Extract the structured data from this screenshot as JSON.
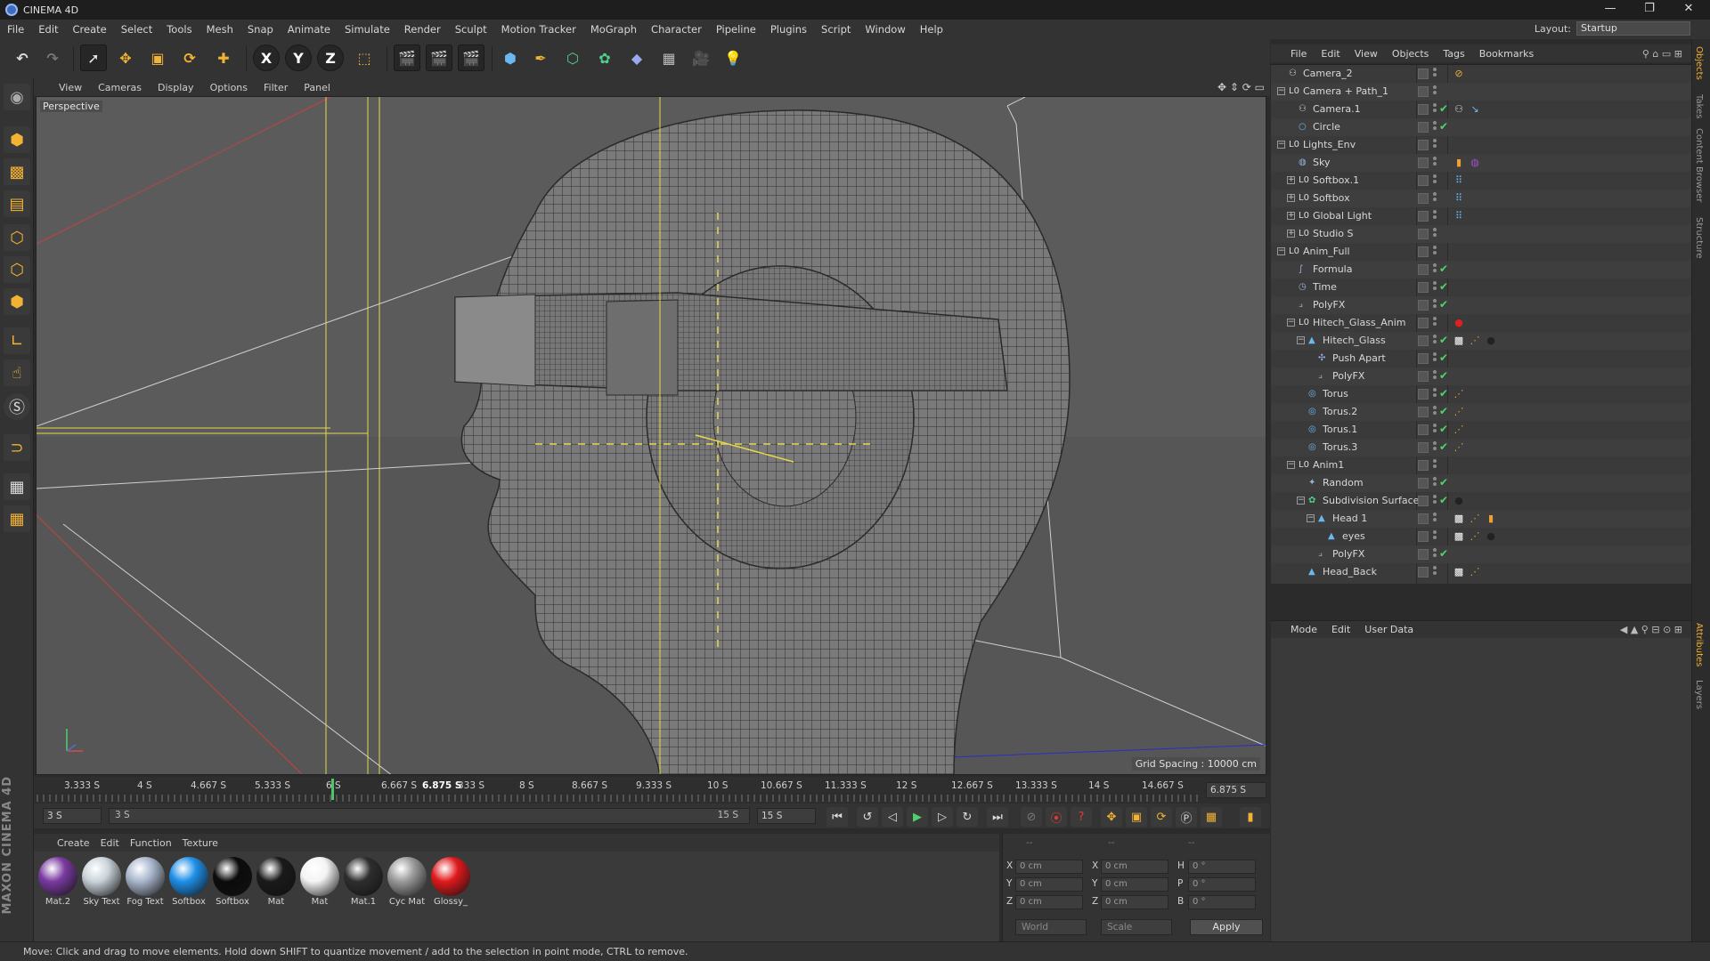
{
  "window": {
    "title": "CINEMA 4D",
    "minimize": "—",
    "restore": "❐",
    "close": "✕"
  },
  "menu": [
    "File",
    "Edit",
    "Create",
    "Select",
    "Tools",
    "Mesh",
    "Snap",
    "Animate",
    "Simulate",
    "Render",
    "Sculpt",
    "Motion Tracker",
    "MoGraph",
    "Character",
    "Pipeline",
    "Plugins",
    "Script",
    "Window",
    "Help"
  ],
  "layout": {
    "label": "Layout:",
    "value": "Startup"
  },
  "toolbar": {
    "x_label": "X",
    "y_label": "Y",
    "z_label": "Z"
  },
  "viewport": {
    "menu": [
      "View",
      "Cameras",
      "Display",
      "Options",
      "Filter",
      "Panel"
    ],
    "camera_label": "Perspective",
    "grid_spacing": "Grid Spacing : 10000 cm"
  },
  "timeline": {
    "ticks": [
      "3.333 S",
      "4 S",
      "4.667 S",
      "5.333 S",
      "6 S",
      "6.667 S",
      "6.875 S",
      "333 S",
      "8 S",
      "8.667 S",
      "9.333 S",
      "10 S",
      "10.667 S",
      "11.333 S",
      "12 S",
      "12.667 S",
      "13.333 S",
      "14 S",
      "14.667 S"
    ],
    "current_time": "6.875 S",
    "current_fraction": 0.255,
    "start_field": "3 S",
    "range_start": "3 S",
    "range_end": "15 S",
    "end_field": "15 S"
  },
  "materials": {
    "menu": [
      "Create",
      "Edit",
      "Function",
      "Texture"
    ],
    "items": [
      {
        "label": "Mat.2",
        "color": "#7a3aa0"
      },
      {
        "label": "Sky Text",
        "color": "#c9d3da"
      },
      {
        "label": "Fog Text",
        "color": "#a9b6cc"
      },
      {
        "label": "Softbox",
        "color": "#1e8fe8"
      },
      {
        "label": "Softbox",
        "color": "#0b0b0b"
      },
      {
        "label": "Mat",
        "color": "#1a1a1a"
      },
      {
        "label": "Mat",
        "color": "#f4f4f4"
      },
      {
        "label": "Mat.1",
        "color": "#2e2e2e"
      },
      {
        "label": "Cyc Mat",
        "color": "#9a9a9a"
      },
      {
        "label": "Glossy_",
        "color": "#e0191c"
      }
    ]
  },
  "coordinates": {
    "headers": [
      "--",
      "--",
      "--"
    ],
    "rows": [
      {
        "a": "X",
        "av": "0 cm",
        "b": "X",
        "bv": "0 cm",
        "c": "H",
        "cv": "0 °"
      },
      {
        "a": "Y",
        "av": "0 cm",
        "b": "Y",
        "bv": "0 cm",
        "c": "P",
        "cv": "0 °"
      },
      {
        "a": "Z",
        "av": "0 cm",
        "b": "Z",
        "bv": "0 cm",
        "c": "B",
        "cv": "0 °"
      }
    ],
    "mode": "World",
    "scale": "Scale",
    "apply": "Apply"
  },
  "objects": {
    "menu": [
      "File",
      "Edit",
      "View",
      "Objects",
      "Tags",
      "Bookmarks"
    ],
    "items": [
      {
        "name": "Camera_2",
        "depth": 0,
        "icon": "camera"
      },
      {
        "name": "Camera + Path_1",
        "depth": 0,
        "icon": "null",
        "expand": "−"
      },
      {
        "name": "Camera.1",
        "depth": 1,
        "icon": "camera"
      },
      {
        "name": "Circle",
        "depth": 1,
        "icon": "spline"
      },
      {
        "name": "Lights_Env",
        "depth": 0,
        "icon": "null",
        "expand": "−"
      },
      {
        "name": "Sky",
        "depth": 1,
        "icon": "sky"
      },
      {
        "name": "Softbox.1",
        "depth": 1,
        "icon": "null",
        "expand": "+"
      },
      {
        "name": "Softbox",
        "depth": 1,
        "icon": "null",
        "expand": "+"
      },
      {
        "name": "Global Light",
        "depth": 1,
        "icon": "null",
        "expand": "+"
      },
      {
        "name": "Studio S",
        "depth": 1,
        "icon": "null",
        "expand": "+"
      },
      {
        "name": "Anim_Full",
        "depth": 0,
        "icon": "null",
        "expand": "−"
      },
      {
        "name": "Formula",
        "depth": 1,
        "icon": "formula"
      },
      {
        "name": "Time",
        "depth": 1,
        "icon": "time"
      },
      {
        "name": "PolyFX",
        "depth": 1,
        "icon": "polyfx"
      },
      {
        "name": "Hitech_Glass_Anim",
        "depth": 1,
        "icon": "null",
        "expand": "−"
      },
      {
        "name": "Hitech_Glass",
        "depth": 2,
        "icon": "mesh",
        "expand": "−"
      },
      {
        "name": "Push Apart",
        "depth": 3,
        "icon": "push"
      },
      {
        "name": "PolyFX",
        "depth": 3,
        "icon": "polyfx"
      },
      {
        "name": "Torus",
        "depth": 2,
        "icon": "torus"
      },
      {
        "name": "Torus.2",
        "depth": 2,
        "icon": "torus"
      },
      {
        "name": "Torus.1",
        "depth": 2,
        "icon": "torus"
      },
      {
        "name": "Torus.3",
        "depth": 2,
        "icon": "torus"
      },
      {
        "name": "Anim1",
        "depth": 1,
        "icon": "null",
        "expand": "−"
      },
      {
        "name": "Random",
        "depth": 2,
        "icon": "random"
      },
      {
        "name": "Subdivision Surface",
        "depth": 2,
        "icon": "subdiv",
        "expand": "−"
      },
      {
        "name": "Head 1",
        "depth": 3,
        "icon": "mesh",
        "expand": "−"
      },
      {
        "name": "eyes",
        "depth": 4,
        "icon": "mesh"
      },
      {
        "name": "PolyFX",
        "depth": 3,
        "icon": "polyfx"
      },
      {
        "name": "Head_Back",
        "depth": 2,
        "icon": "mesh"
      }
    ]
  },
  "attributes": {
    "menu": [
      "Mode",
      "Edit",
      "User Data"
    ]
  },
  "right_tabs": [
    "Objects",
    "Takes",
    "Content Browser",
    "Structure",
    "Attributes",
    "Layers"
  ],
  "brand": "MAXON CINEMA 4D",
  "status": "Move: Click and drag to move elements. Hold down SHIFT to quantize movement / add to the selection in point mode, CTRL to remove."
}
